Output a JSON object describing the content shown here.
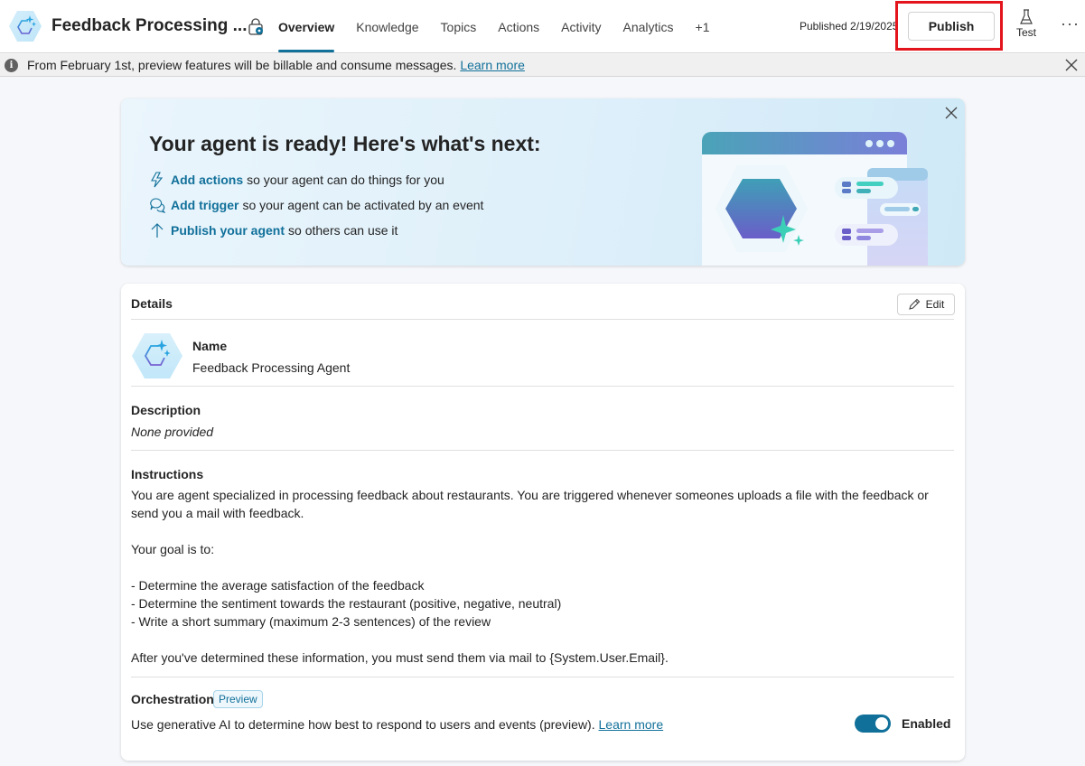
{
  "header": {
    "agent_title": "Feedback Processing ...",
    "tabs": [
      {
        "label": "Overview",
        "active": true
      },
      {
        "label": "Knowledge"
      },
      {
        "label": "Topics"
      },
      {
        "label": "Actions"
      },
      {
        "label": "Activity"
      },
      {
        "label": "Analytics"
      },
      {
        "label": "+1"
      }
    ],
    "published_status": "Published 2/19/2025",
    "publish_label": "Publish",
    "test_label": "Test",
    "more_label": "···"
  },
  "info_banner": {
    "icon": "info-icon",
    "text": "From February 1st, preview features will be billable and consume messages.",
    "link": "Learn more"
  },
  "hero": {
    "title": "Your agent is ready! Here's what's next:",
    "items": [
      {
        "icon": "lightning-icon",
        "link": "Add actions",
        "text": "so your agent can do things for you"
      },
      {
        "icon": "chat-bubbles-icon",
        "link": "Add trigger",
        "text": "so your agent can be activated by an event"
      },
      {
        "icon": "arrow-up-icon",
        "link": "Publish your agent",
        "text": "so others can use it"
      }
    ]
  },
  "details": {
    "title": "Details",
    "edit_label": "Edit",
    "name_label": "Name",
    "name_value": "Feedback Processing Agent",
    "description_label": "Description",
    "description_value": "None provided",
    "instructions_label": "Instructions",
    "instructions_lines": [
      "You are agent specialized in processing feedback about restaurants. You are triggered whenever someones uploads a file with the feedback or send you a mail with feedback.",
      "",
      "Your goal is to:",
      "",
      "- Determine the average satisfaction of the feedback",
      "- Determine the sentiment towards the restaurant (positive, negative, neutral)",
      "- Write a short summary (maximum 2-3 sentences) of the review",
      "",
      "After you've determined these information, you must send them via mail to {System.User.Email}."
    ],
    "orchestration_label": "Orchestration",
    "orchestration_badge": "Preview",
    "orchestration_text": "Use generative AI to determine how best to respond to users and events (preview).",
    "orchestration_link": "Learn more",
    "orchestration_enabled": true,
    "toggle_label": "Enabled"
  },
  "colors": {
    "accent": "#11709a",
    "highlight_border": "#e3141c"
  }
}
